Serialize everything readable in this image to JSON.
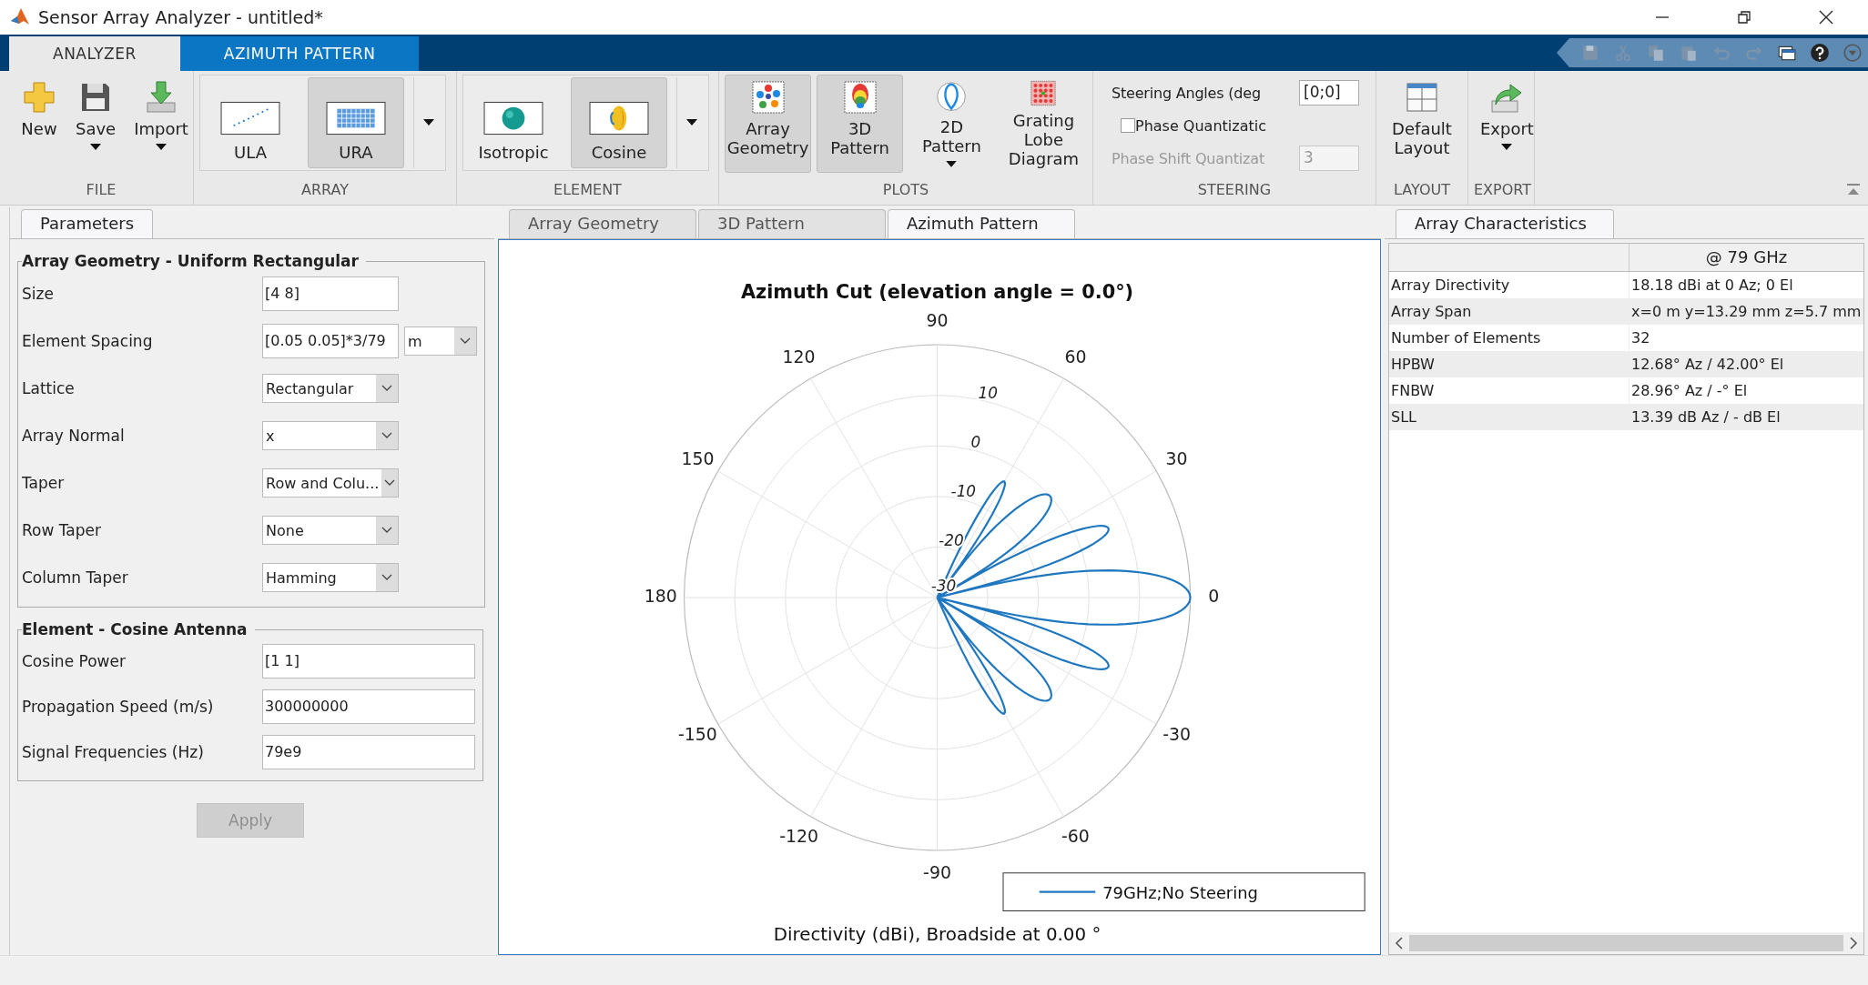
{
  "window": {
    "title": "Sensor Array Analyzer - untitled*"
  },
  "ribbon_tabs": [
    {
      "label": "ANALYZER",
      "selected": true
    },
    {
      "label": "AZIMUTH PATTERN",
      "selected": false
    }
  ],
  "toolstrip": [
    {
      "label": "FILE",
      "buttons": [
        {
          "kind": "new",
          "label": "New",
          "menu": false,
          "selected": false
        },
        {
          "kind": "save",
          "label": "Save",
          "menu": true,
          "selected": false
        },
        {
          "kind": "import",
          "label": "Import",
          "menu": true,
          "selected": false
        }
      ]
    },
    {
      "label": "ARRAY",
      "gallery": true,
      "buttons": [
        {
          "kind": "ula",
          "label": "ULA",
          "menu": false,
          "selected": false
        },
        {
          "kind": "ura",
          "label": "URA",
          "menu": false,
          "selected": true
        }
      ]
    },
    {
      "label": "ELEMENT",
      "gallery": true,
      "buttons": [
        {
          "kind": "isotropic",
          "label": "Isotropic",
          "menu": false,
          "selected": false
        },
        {
          "kind": "cosine",
          "label": "Cosine",
          "menu": false,
          "selected": true
        }
      ]
    },
    {
      "label": "PLOTS",
      "buttons": [
        {
          "kind": "geometry",
          "label": "Array Geometry",
          "menu": false,
          "selected": true
        },
        {
          "kind": "pattern3d",
          "label": "3D Pattern",
          "menu": false,
          "selected": true
        },
        {
          "kind": "pattern2d",
          "label": "2D Pattern",
          "menu": true,
          "selected": false
        },
        {
          "kind": "grating",
          "label": "Grating Lobe Diagram",
          "menu": false,
          "selected": false
        }
      ]
    },
    {
      "label": "STEERING",
      "steering": [
        {
          "kind": "field",
          "label": "Steering Angles (deg",
          "value": "[0;0]",
          "disabled": false
        },
        {
          "kind": "checkbox",
          "label": "Phase Quantizatic",
          "checked": false
        },
        {
          "kind": "field",
          "label": "Phase Shift Quantizat",
          "value": "3",
          "disabled": true
        }
      ]
    },
    {
      "label": "LAYOUT",
      "buttons": [
        {
          "kind": "layout",
          "label": "Default Layout",
          "menu": false,
          "selected": false
        }
      ]
    },
    {
      "label": "EXPORT",
      "buttons": [
        {
          "kind": "export",
          "label": "Export",
          "menu": true,
          "selected": false
        }
      ]
    }
  ],
  "parameters": {
    "tab": "Parameters",
    "groups": [
      {
        "title": "Array Geometry - Uniform Rectangular",
        "fields": [
          {
            "label": "Size",
            "kind": "text",
            "value": "[4 8]"
          },
          {
            "label": "Element Spacing",
            "kind": "text",
            "value": "[0.05 0.05]*3/79",
            "unit": "m"
          },
          {
            "label": "Lattice",
            "kind": "dropdown",
            "value": "Rectangular"
          },
          {
            "label": "Array Normal",
            "kind": "dropdown",
            "value": "x"
          },
          {
            "label": "Taper",
            "kind": "dropdown",
            "value": "Row and Colu..."
          },
          {
            "label": "Row Taper",
            "kind": "dropdown",
            "value": "None"
          },
          {
            "label": "Column Taper",
            "kind": "dropdown",
            "value": "Hamming"
          }
        ]
      },
      {
        "title": "Element - Cosine Antenna",
        "fields": [
          {
            "label": "Cosine Power",
            "kind": "text",
            "value": "[1 1]"
          },
          {
            "label": "Propagation Speed (m/s)",
            "kind": "text",
            "value": "300000000"
          },
          {
            "label": "Signal Frequencies (Hz)",
            "kind": "text",
            "value": "79e9"
          }
        ]
      }
    ],
    "apply": {
      "label": "Apply",
      "disabled": true
    }
  },
  "plot_tabs": [
    {
      "label": "Array Geometry",
      "selected": false
    },
    {
      "label": "3D Pattern",
      "selected": false
    },
    {
      "label": "Azimuth Pattern",
      "selected": true
    }
  ],
  "plot": {
    "title": "Azimuth Cut (elevation angle = 0.0°)",
    "angle_labels": [
      {
        "angle": "0"
      },
      {
        "angle": "30"
      },
      {
        "angle": "60"
      },
      {
        "angle": "90"
      },
      {
        "angle": "120"
      },
      {
        "angle": "150"
      },
      {
        "angle": "180"
      },
      {
        "angle": "-150"
      },
      {
        "angle": "-120"
      },
      {
        "angle": "-90"
      },
      {
        "angle": "-60"
      },
      {
        "angle": "-30"
      }
    ],
    "radial_labels": [
      "10",
      "0",
      "-10",
      "-20",
      "-30"
    ],
    "legend": "79GHz;No Steering",
    "xlabel": "Directivity (dBi), Broadside at 0.00 °"
  },
  "characteristics": {
    "tab": "Array Characteristics",
    "header": "@ 79 GHz",
    "rows": [
      {
        "name": "Array Directivity",
        "value": "18.18 dBi at 0 Az; 0 El"
      },
      {
        "name": "Array Span",
        "value": "x=0 m y=13.29 mm z=5.7 mm"
      },
      {
        "name": "Number of Elements",
        "value": "32"
      },
      {
        "name": "HPBW",
        "value": "12.68° Az / 42.00° El"
      },
      {
        "name": "FNBW",
        "value": "28.96° Az / -° El"
      },
      {
        "name": "SLL",
        "value": "13.39 dB Az / - dB El"
      }
    ]
  }
}
